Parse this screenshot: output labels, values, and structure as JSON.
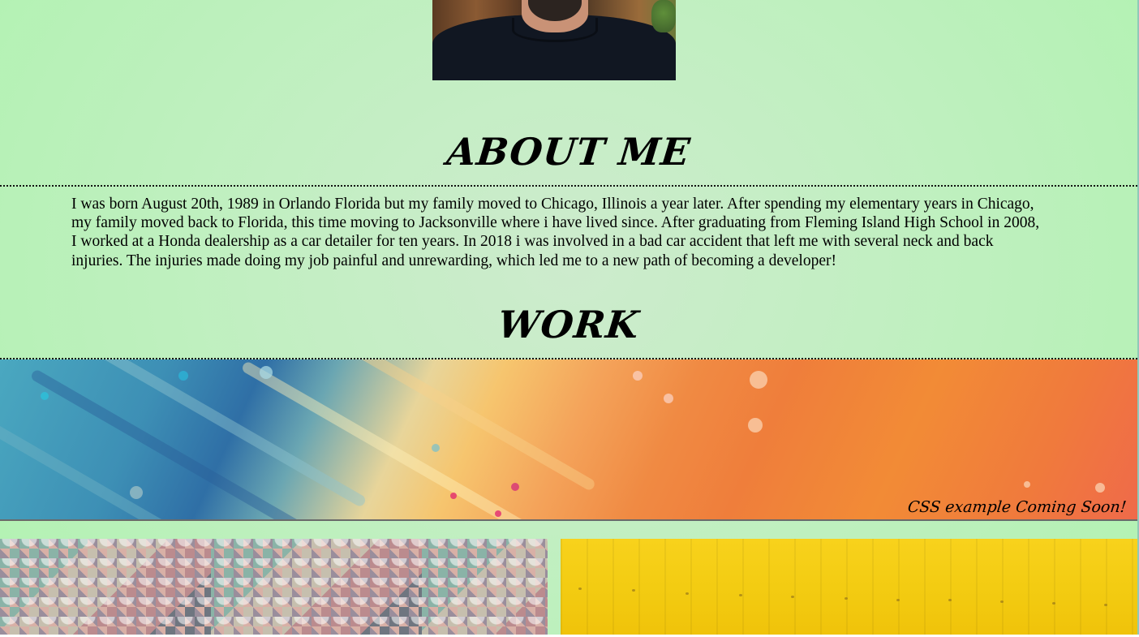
{
  "profile": {
    "photo_description_icon": "profile-photo"
  },
  "about": {
    "heading": "ABOUT ME",
    "body": "I was born August 20th, 1989 in Orlando Florida but my family moved to Chicago, Illinois a year later. After spending my elementary years in Chicago, my family moved back to Florida, this time moving to Jacksonville where i have lived since. After graduating from Fleming Island High School in 2008, I worked at a Honda dealership as a car detailer for ten years. In 2018 i was involved in a bad car accident that left me with several neck and back injuries. The injuries made doing my job painful and unrewarding, which led me to a new path of becoming a developer!"
  },
  "work": {
    "heading": "WORK",
    "banner_caption": "CSS example Coming Soon!"
  },
  "colors": {
    "page_background": "#c2efc2",
    "text": "#000000"
  }
}
